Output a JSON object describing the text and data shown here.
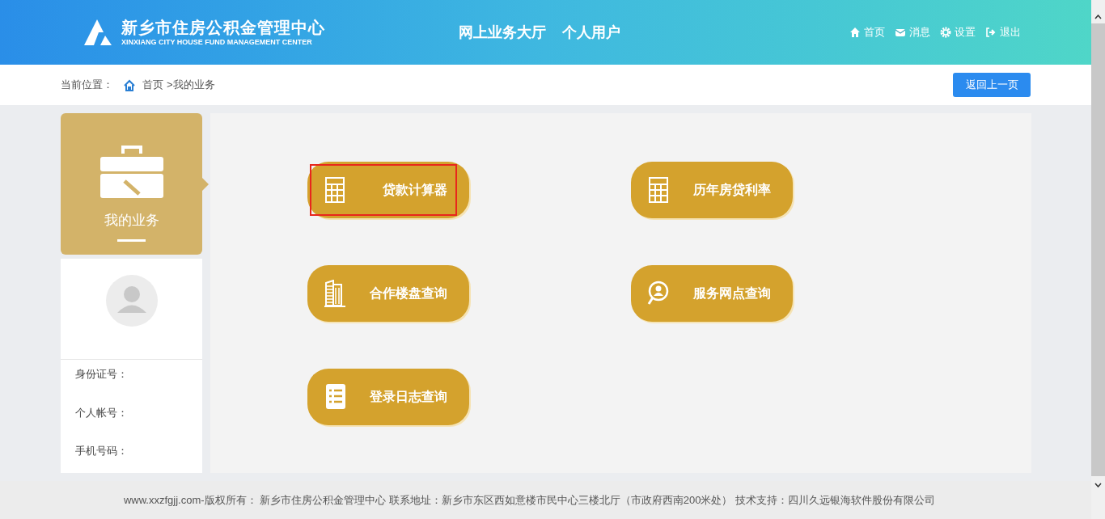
{
  "header": {
    "logo_title": "新乡市住房公积金管理中心",
    "logo_subtitle": "XINXIANG CITY HOUSE FUND MANAGEMENT CENTER",
    "hall_title": "网上业务大厅",
    "user_type": "个人用户",
    "nav": [
      {
        "kind": "home",
        "label": "首页"
      },
      {
        "kind": "message",
        "label": "消息"
      },
      {
        "kind": "settings",
        "label": "设置"
      },
      {
        "kind": "logout",
        "label": "退出"
      }
    ]
  },
  "breadcrumb": {
    "prefix": "当前位置：",
    "home": "首页",
    "current": ">我的业务",
    "back_button": "返回上一页"
  },
  "sidebar": {
    "title": "我的业务",
    "fields": [
      {
        "label": "身份证号："
      },
      {
        "label": "个人帐号："
      },
      {
        "label": "手机号码："
      }
    ]
  },
  "tiles": [
    {
      "kind": "calculator",
      "label": "贷款计算器",
      "highlighted": true
    },
    {
      "kind": "calculator",
      "label": "历年房贷利率",
      "highlighted": false
    },
    {
      "kind": "building",
      "label": "合作楼盘查询",
      "highlighted": false
    },
    {
      "kind": "person-search",
      "label": "服务网点查询",
      "highlighted": false
    },
    {
      "kind": "list",
      "label": "登录日志查询",
      "highlighted": false
    }
  ],
  "footer": "www.xxzfgjj.com-版权所有： 新乡市住房公积金管理中心 联系地址：新乡市东区西如意楼市民中心三楼北厅（市政府西南200米处） 技术支持：四川久远银海软件股份有限公司"
}
